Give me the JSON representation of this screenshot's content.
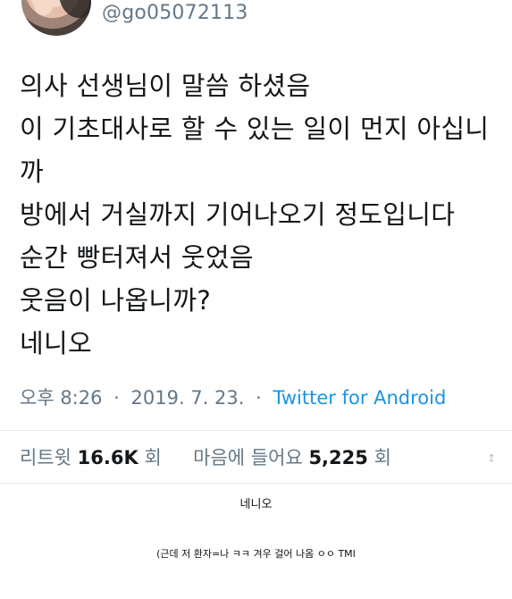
{
  "header": {
    "handle": "@go05072113"
  },
  "tweet": {
    "lines": [
      "의사 선생님이 말씀 하셨음",
      "이 기초대사로 할 수 있는 일이 먼지 아십니",
      "까",
      "방에서 거실까지 기어나오기 정도입니다",
      "순간 빵터져서 웃었음",
      "웃음이 나옵니까?",
      "네니오"
    ]
  },
  "meta": {
    "time": "오후 8:26",
    "separator": "·",
    "date": "2019. 7. 23.",
    "source": "Twitter for Android"
  },
  "stats": {
    "retweets_label": "리트윗",
    "retweets_count": "16.6K",
    "retweets_suffix": "회",
    "likes_label": "마음에 들어요",
    "likes_count": "5,225",
    "likes_suffix": "회"
  },
  "icons": {
    "share": "share-icon"
  },
  "captions": {
    "primary": "네니오",
    "secondary": "(근데 저 환자=나 ㅋㅋ 겨우 걸어 나옴 ㅇㅇ TMI"
  },
  "colors": {
    "text": "#14171a",
    "muted": "#657786",
    "link": "#1b95e0",
    "divider": "#e6ecf0"
  }
}
